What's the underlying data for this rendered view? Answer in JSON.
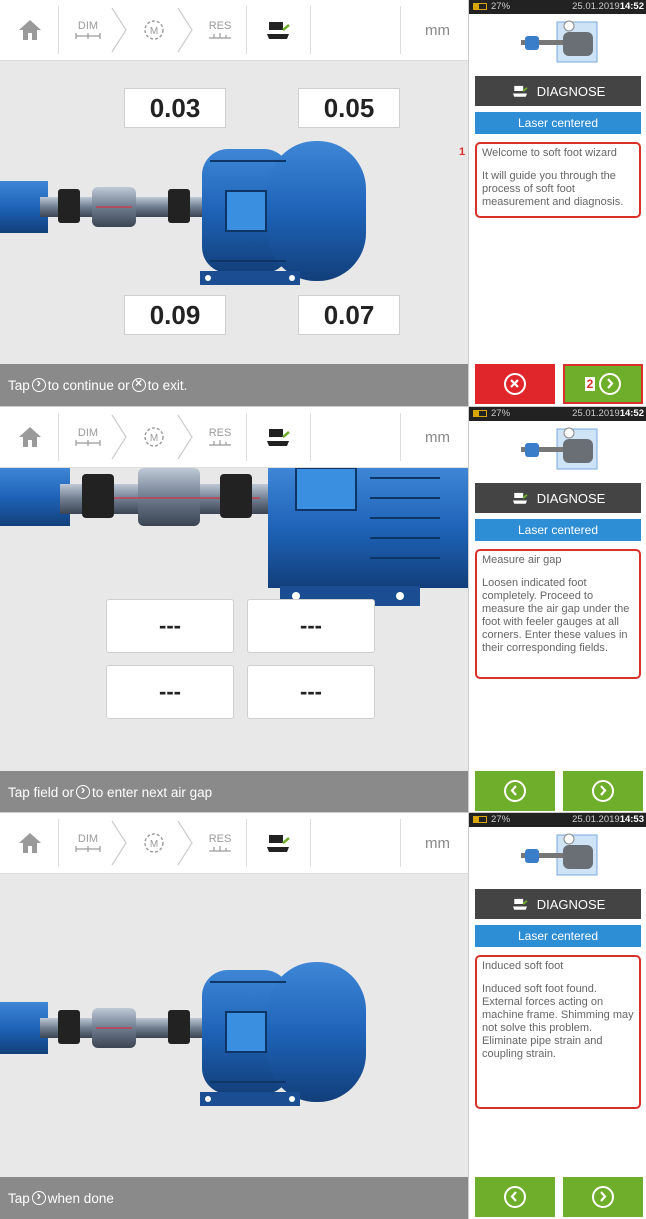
{
  "toolbar": {
    "home_label": "",
    "dim_label": "DIM",
    "meas_label": "M",
    "res_label": "RES",
    "unit": "mm"
  },
  "side_common": {
    "battery": "27%",
    "diagnose_label": "DIAGNOSE",
    "laser_label": "Laser centered"
  },
  "panels": [
    {
      "date": "25.01.2019",
      "time": "14:52",
      "values": [
        "0.03",
        "0.05",
        "0.09",
        "0.07"
      ],
      "message_title": "Welcome to soft foot wizard",
      "message_body": "It will guide you through the process of soft foot measurement and diagnosis.",
      "status_pre": "Tap",
      "status_mid": "to continue or",
      "status_post": "to exit.",
      "callout_1": "1",
      "callout_2": "2"
    },
    {
      "date": "25.01.2019",
      "time": "14:52",
      "inputs": [
        "---",
        "---",
        "---",
        "---"
      ],
      "message_title": "Measure air gap",
      "message_body": "Loosen indicated foot completely. Proceed to measure the air gap under the foot with feeler gauges at all corners. Enter these values in their corresponding fields.",
      "status_pre": "Tap field or",
      "status_post": "to enter next air gap"
    },
    {
      "date": "25.01.2019",
      "time": "14:53",
      "message_title": "Induced soft foot",
      "message_body": "Induced soft foot found. External forces acting on machine frame. Shimming may not solve this problem. Eliminate pipe strain and coupling strain.",
      "status_pre": "Tap",
      "status_post": "when done"
    }
  ],
  "colors": {
    "accent_green": "#6fae2b",
    "exit_red": "#e0262b",
    "highlight_red": "#d9302a",
    "laser_blue": "#2d8ed6",
    "motor_blue": "#1e63b8"
  },
  "icons": [
    "home-icon",
    "dim-icon",
    "measure-icon",
    "results-icon",
    "softfoot-icon",
    "next-icon",
    "back-icon",
    "exit-icon"
  ]
}
